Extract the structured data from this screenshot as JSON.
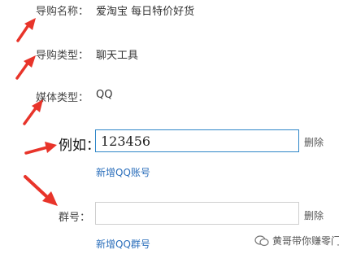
{
  "form": {
    "guide_name": {
      "label": "导购名称：",
      "value": "爱淘宝 每日特价好货"
    },
    "guide_type": {
      "label": "导购类型：",
      "value": "聊天工具"
    },
    "media_type": {
      "label": "媒体类型：",
      "value": "QQ"
    },
    "example": {
      "label": "例如：",
      "input_value": "123456",
      "delete_label": "删除",
      "add_link": "新增QQ账号"
    },
    "group": {
      "label": "群号：",
      "input_value": "",
      "delete_label": "删除",
      "add_link": "新增QQ群号"
    }
  },
  "annotation": {
    "arrow_color": "#e8342a"
  },
  "watermark": {
    "text": "黄哥带你赚零门",
    "icon": "wechat-icon"
  }
}
